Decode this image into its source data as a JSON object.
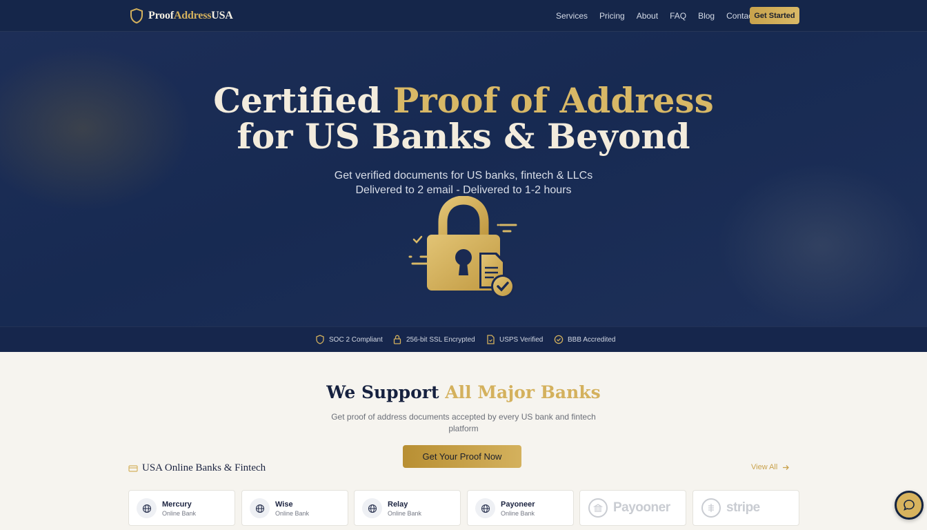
{
  "brand": {
    "part1": "Proof",
    "part2": "Address",
    "part3": "USA"
  },
  "nav": {
    "links": [
      "Services",
      "Pricing",
      "About",
      "FAQ",
      "Blog",
      "Contact"
    ],
    "cta": "Get Started"
  },
  "hero": {
    "title_line1_a": "Certified ",
    "title_line1_b": "Proof of Address",
    "title_line2": "for US Banks & Beyond",
    "subtitle_line1": "Get verified documents for US banks, fintech & LLCs",
    "subtitle_line2": "Delivered to 2 email - Delivered to 1-2 hours"
  },
  "trust": [
    {
      "label": "SOC 2 Compliant",
      "icon": "shield-icon"
    },
    {
      "label": "256-bit SSL Encrypted",
      "icon": "lock-icon"
    },
    {
      "label": "USPS Verified",
      "icon": "document-icon"
    },
    {
      "label": "BBB Accredited",
      "icon": "check-circle-icon"
    }
  ],
  "banks": {
    "title_a": "We Support ",
    "title_b": "All Major Banks",
    "subtitle": "Get proof of address documents accepted by every US bank and fintech platform",
    "cta": "Get Your Proof Now",
    "category": "USA Online Banks & Fintech",
    "view_all": "View All",
    "cards": [
      {
        "name": "Mercury",
        "type": "Online Bank"
      },
      {
        "name": "Wise",
        "type": "Online Bank"
      },
      {
        "name": "Relay",
        "type": "Online Bank"
      },
      {
        "name": "Payoneer",
        "type": "Online Bank"
      }
    ],
    "logo_cards": [
      "Payooner",
      "stripe"
    ]
  },
  "colors": {
    "navy": "#16264c",
    "gold": "#d4b15d",
    "cream": "#f6f4ef"
  }
}
